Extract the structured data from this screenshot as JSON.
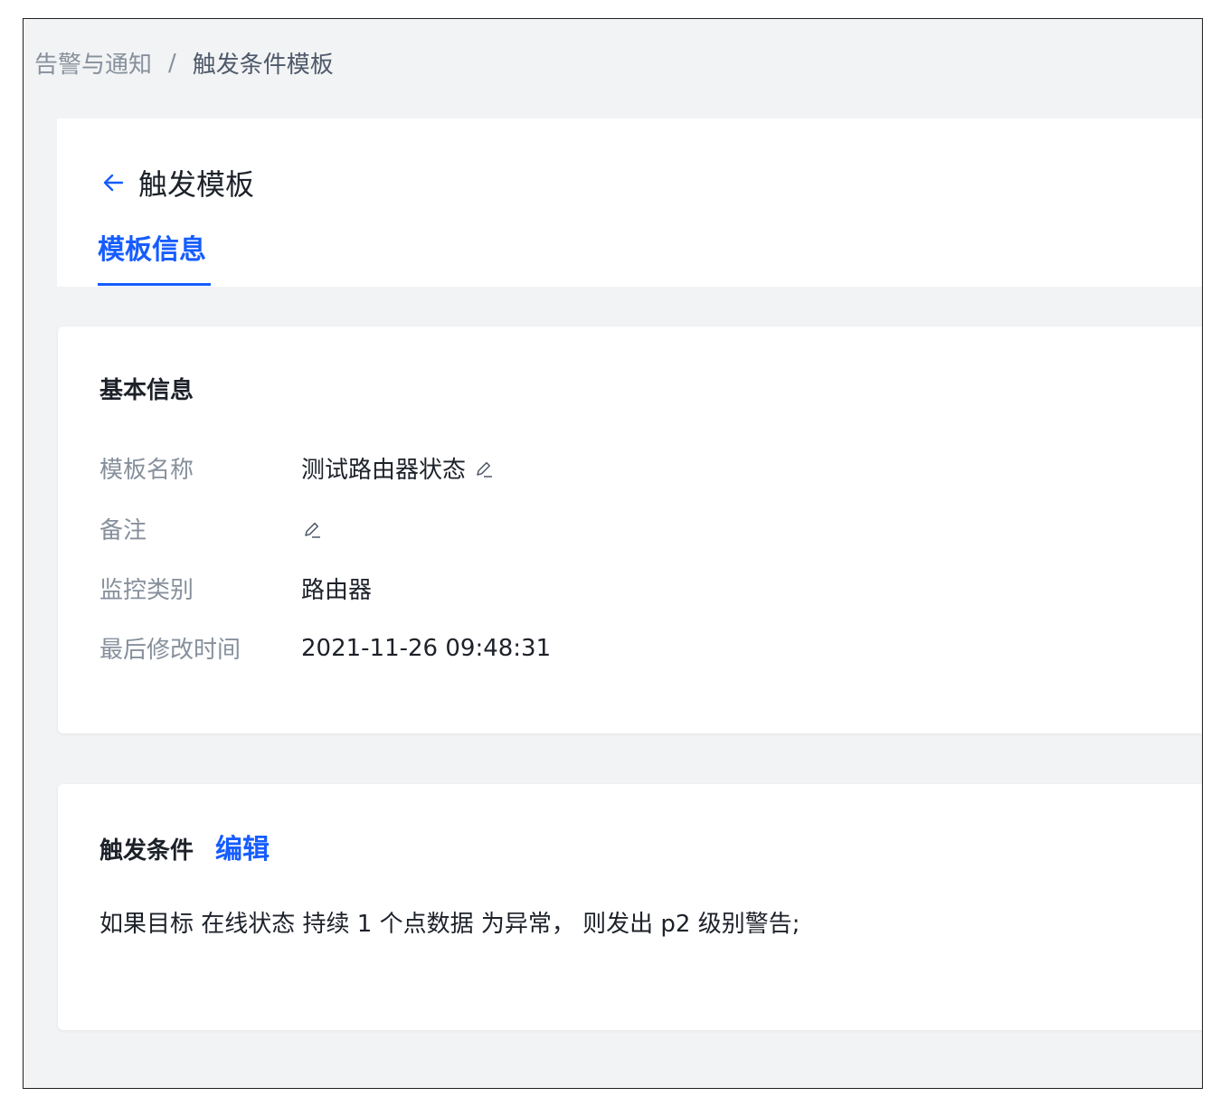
{
  "breadcrumb": {
    "parent": "告警与通知",
    "separator": "/",
    "current": "触发条件模板"
  },
  "header": {
    "back_icon": "arrow-left-icon",
    "title": "触发模板",
    "tabs": [
      {
        "label": "模板信息",
        "active": true
      }
    ]
  },
  "basic_info": {
    "section_title": "基本信息",
    "rows": [
      {
        "label": "模板名称",
        "value": "测试路由器状态",
        "editable": true
      },
      {
        "label": "备注",
        "value": "",
        "editable": true
      },
      {
        "label": "监控类别",
        "value": "路由器",
        "editable": false
      },
      {
        "label": "最后修改时间",
        "value": "2021-11-26 09:48:31",
        "editable": false
      }
    ]
  },
  "trigger_conditions": {
    "section_title": "触发条件",
    "edit_label": "编辑",
    "text": "如果目标 在线状态 持续 1 个点数据 为异常， 则发出 p2 级别警告;"
  },
  "colors": {
    "accent": "#165dff",
    "page_background": "#f2f3f5",
    "label_text": "#86909c",
    "body_text": "#1d2129"
  }
}
